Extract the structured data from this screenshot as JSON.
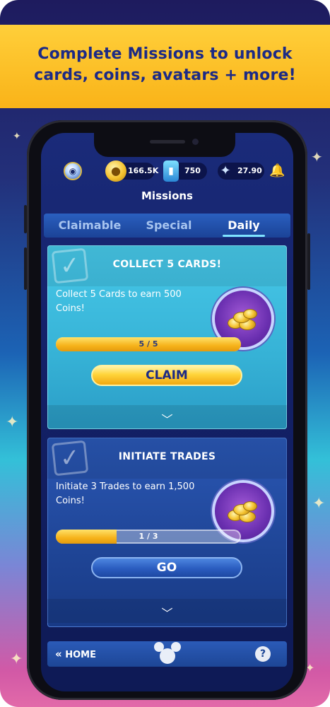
{
  "banner": {
    "line1": "Complete Missions to unlock",
    "line2": "cards, coins, avatars + more!"
  },
  "header": {
    "currencies": [
      {
        "icon": "coin-icon",
        "value": "166.5K"
      },
      {
        "icon": "card-icon",
        "value": "750"
      },
      {
        "icon": "sparkle-icon",
        "value": "27.90"
      }
    ],
    "title": "Missions"
  },
  "tabs": [
    {
      "label": "Claimable",
      "active": false
    },
    {
      "label": "Special",
      "active": false
    },
    {
      "label": "Daily",
      "active": true
    }
  ],
  "missions": [
    {
      "title": "COLLECT 5 CARDS!",
      "description": "Collect 5 Cards to earn 500 Coins!",
      "progress_text": "5 / 5",
      "progress": 1.0,
      "action": "CLAIM",
      "reward_icon": "coin-pile-icon"
    },
    {
      "title": "INITIATE TRADES",
      "description": "Initiate 3 Trades to earn 1,500 Coins!",
      "progress_text": "1 / 3",
      "progress": 0.333,
      "action": "GO",
      "reward_icon": "coin-pile-icon"
    }
  ],
  "footer": {
    "home_label": "HOME",
    "help_label": "?"
  },
  "colors": {
    "banner": "#ffcf3a",
    "banner_text": "#1c2a86",
    "claim": "#ffd43a",
    "go": "#2a5cbf",
    "teal_card": "#47c8e8",
    "navy_card": "#2a57b4"
  }
}
